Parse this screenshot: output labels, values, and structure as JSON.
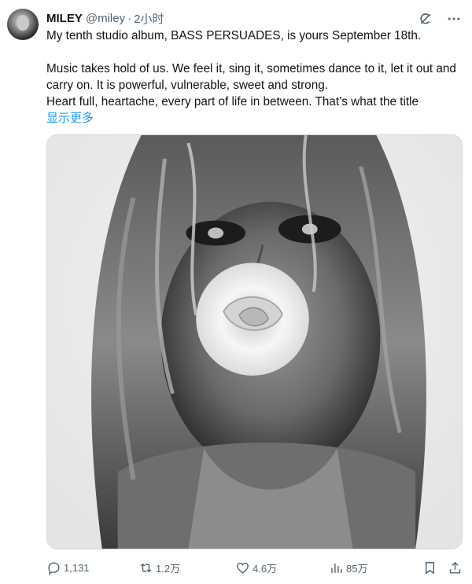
{
  "author": {
    "name": "MILEY",
    "handle": "@miley",
    "separator": "·",
    "time": "2小时"
  },
  "tweet": {
    "line1": "My tenth studio album, BASS PERSUADES, is yours September 18th.",
    "line2": "Music takes hold of us. We feel it, sing it, sometimes dance to it, let it out and carry on. It is powerful, vulnerable, sweet and strong.",
    "line3": "Heart full, heartache, every part of life in between. That’s what the title",
    "show_more": "显示更多"
  },
  "icons": {
    "grok": "grok-icon",
    "more": "more-icon",
    "reply": "reply-icon",
    "retweet": "retweet-icon",
    "like": "heart-icon",
    "views": "views-icon",
    "bookmark": "bookmark-icon",
    "share": "share-icon"
  },
  "stats": {
    "replies": "1,131",
    "retweets": "1.2万",
    "likes": "4.6万",
    "views": "85万"
  },
  "colors": {
    "link": "#1d9bf0",
    "muted": "#536471",
    "text": "#0f1419"
  }
}
